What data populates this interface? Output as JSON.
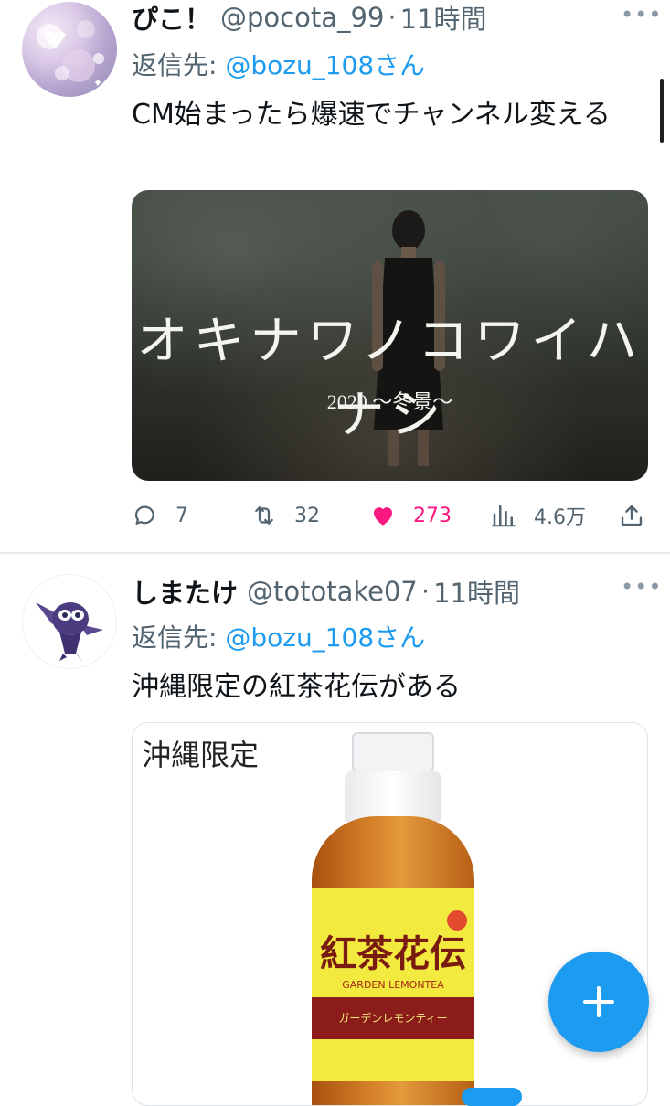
{
  "tweets": [
    {
      "display_name": "ぴこ！",
      "handle": "@pocota_99",
      "separator": "·",
      "time": "11時間",
      "reply_prefix": "返信先: ",
      "reply_to": "@bozu_108さん",
      "text": "CM始まったら爆速でチャンネル変える",
      "media": {
        "title": "オキナワノコワイハナシ",
        "subtitle": "2020 〜冬景〜"
      },
      "actions": {
        "replies": "7",
        "retweets": "32",
        "likes": "273",
        "views": "4.6万"
      },
      "liked": true
    },
    {
      "display_name": "しまたけ",
      "handle": "@tototake07",
      "separator": "·",
      "time": "11時間",
      "reply_prefix": "返信先: ",
      "reply_to": "@bozu_108さん",
      "text": "沖縄限定の紅茶花伝がある",
      "media": {
        "label": "沖縄限定",
        "brand": "紅茶花伝",
        "band_text": "ガーデンレモンティー",
        "lemon_text": "GARDEN LEMONTEA"
      }
    }
  ],
  "colors": {
    "accent": "#1d9bf0",
    "like": "#f91880",
    "muted": "#536471",
    "text": "#0f1419"
  },
  "icons": {
    "more": "more-horizontal-icon",
    "reply": "reply-bubble-icon",
    "retweet": "retweet-icon",
    "like": "heart-filled-icon",
    "views": "analytics-bars-icon",
    "share": "share-upload-icon",
    "compose": "plus-icon"
  }
}
